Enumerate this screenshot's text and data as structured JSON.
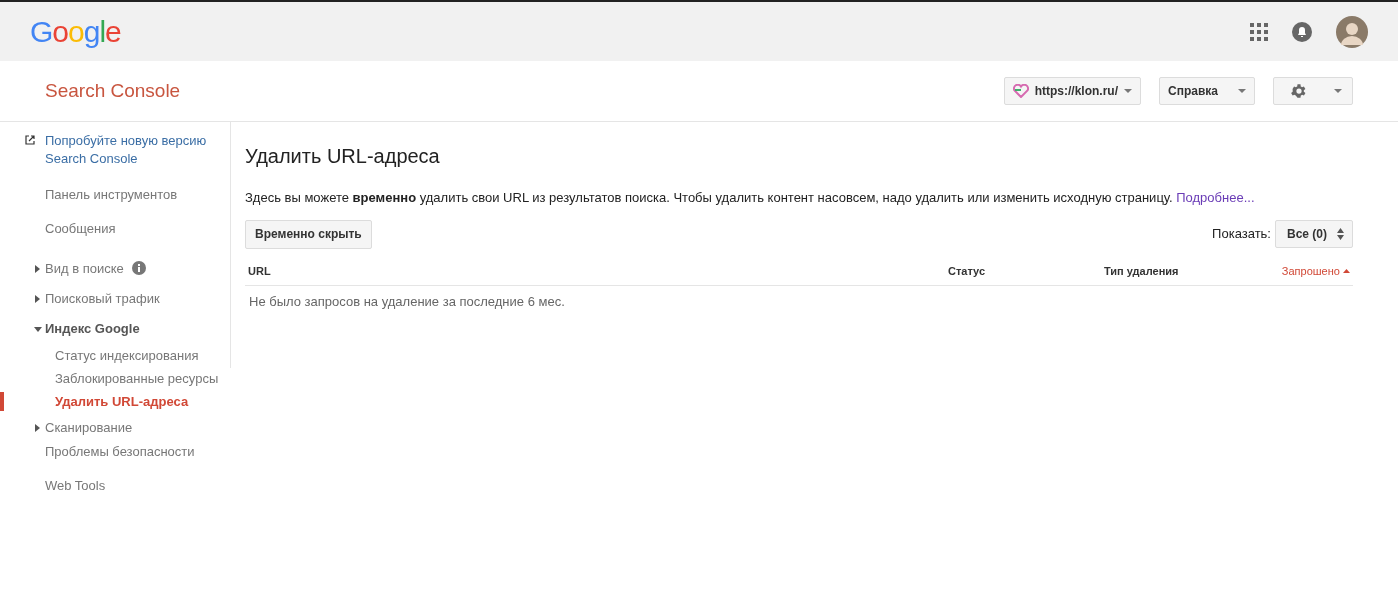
{
  "topbar": {
    "logo": "Google"
  },
  "header": {
    "product": "Search Console",
    "property": "https://klon.ru/",
    "help": "Справка"
  },
  "sidebar": {
    "items": [
      {
        "kind": "external",
        "label": "Попробуйте новую версию Search Console"
      },
      {
        "kind": "plain",
        "label": "Панель инструментов",
        "selected": false
      },
      {
        "kind": "plain",
        "label": "Сообщения",
        "selected": false
      },
      {
        "kind": "group",
        "label": "Вид в поиске",
        "expanded": false,
        "info": true
      },
      {
        "kind": "group",
        "label": "Поисковый трафик",
        "expanded": false
      },
      {
        "kind": "group",
        "label": "Индекс Google",
        "expanded": true,
        "children": [
          {
            "label": "Статус индексирования",
            "selected": false
          },
          {
            "label": "Заблокированные ресурсы",
            "selected": false
          },
          {
            "label": "Удалить URL-адреса",
            "selected": true
          }
        ]
      },
      {
        "kind": "group",
        "label": "Сканирование",
        "expanded": false
      },
      {
        "kind": "plain",
        "label": "Проблемы безопасности",
        "selected": false
      },
      {
        "kind": "plain",
        "label": "Web Tools",
        "selected": false
      }
    ]
  },
  "main": {
    "title": "Удалить URL-адреса",
    "description": "Здесь вы можете **временно** удалить свои URL из результатов поиска. Чтобы удалить контент насовсем, надо удалить или изменить исходную страницу.",
    "more_link": "Подробнее...",
    "hide_button": "Временно скрыть",
    "show_label": "Показать:",
    "show_value": "Все (0)",
    "table": {
      "columns": [
        {
          "label": "URL",
          "sorted": false
        },
        {
          "label": "Статус",
          "sorted": false
        },
        {
          "label": "Тип удаления",
          "sorted": false
        },
        {
          "label": "Запрошено",
          "sorted": true
        }
      ],
      "empty_message": "Не было запросов на удаление за последние 6 мес."
    }
  }
}
